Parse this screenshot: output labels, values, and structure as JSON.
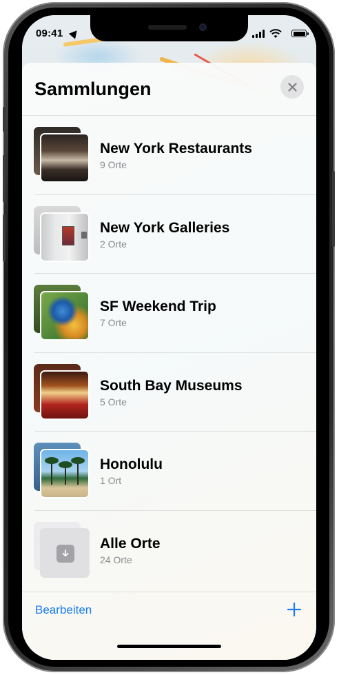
{
  "status_bar": {
    "time": "09:41"
  },
  "sheet": {
    "title": "Sammlungen",
    "close_icon": "close-icon"
  },
  "collections": [
    {
      "title": "New York Restaurants",
      "count": "9 Orte",
      "thumbnail": "restaurant-photo"
    },
    {
      "title": "New York Galleries",
      "count": "2 Orte",
      "thumbnail": "gallery-photo"
    },
    {
      "title": "SF Weekend Trip",
      "count": "7 Orte",
      "thumbnail": "parrot-photo"
    },
    {
      "title": "South Bay Museums",
      "count": "5 Orte",
      "thumbnail": "theater-photo"
    },
    {
      "title": "Honolulu",
      "count": "1 Ort",
      "thumbnail": "beach-photo"
    },
    {
      "title": "Alle Orte",
      "count": "24 Orte",
      "thumbnail": "download-icon"
    }
  ],
  "footer": {
    "edit_label": "Bearbeiten",
    "add_icon": "plus-icon"
  },
  "colors": {
    "accent": "#1a7cf5",
    "subtitle": "#8a8a8e"
  }
}
